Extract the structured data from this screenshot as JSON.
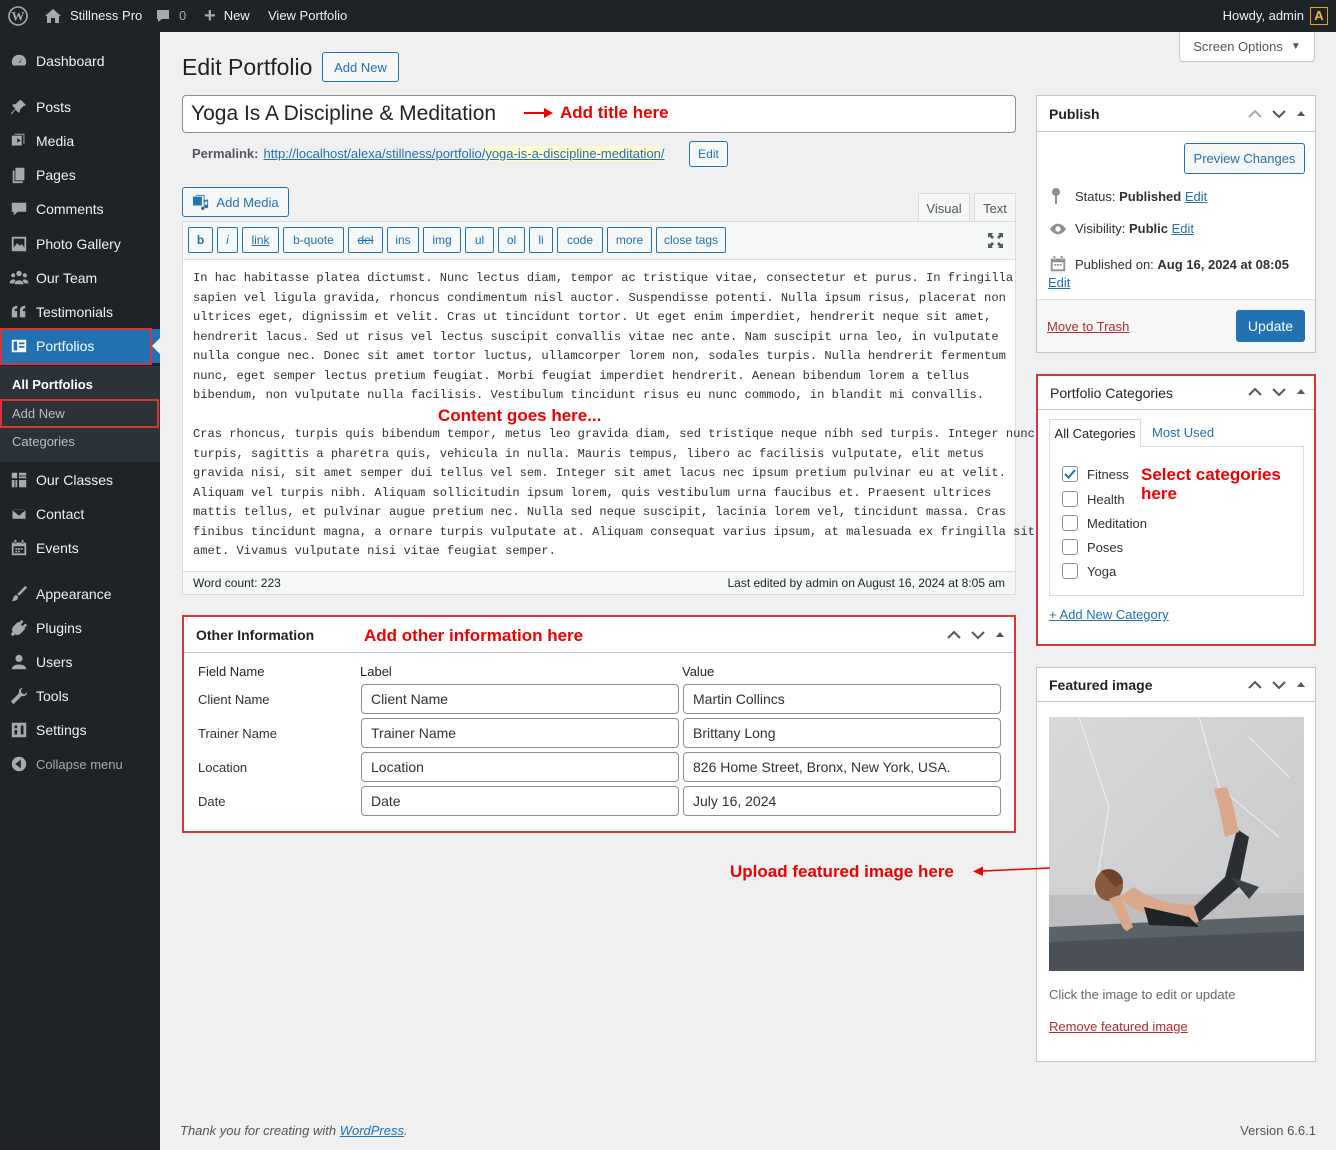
{
  "adminbar": {
    "site_name": "Stillness Pro",
    "comments_count": "0",
    "new_label": "New",
    "view_label": "View Portfolio",
    "greeting": "Howdy, admin"
  },
  "sidebar": {
    "items": [
      {
        "label": "Dashboard",
        "icon": "dashboard-icon"
      },
      {
        "label": "Posts",
        "icon": "pin-icon"
      },
      {
        "label": "Media",
        "icon": "media-icon"
      },
      {
        "label": "Pages",
        "icon": "pages-icon"
      },
      {
        "label": "Comments",
        "icon": "comment-icon"
      },
      {
        "label": "Photo Gallery",
        "icon": "gallery-icon"
      },
      {
        "label": "Our Team",
        "icon": "groups-icon"
      },
      {
        "label": "Testimonials",
        "icon": "quote-icon"
      },
      {
        "label": "Portfolios",
        "icon": "portfolio-icon"
      },
      {
        "label": "Our Classes",
        "icon": "grid-icon"
      },
      {
        "label": "Contact",
        "icon": "email-icon"
      },
      {
        "label": "Events",
        "icon": "calendar-icon"
      },
      {
        "label": "Appearance",
        "icon": "brush-icon"
      },
      {
        "label": "Plugins",
        "icon": "plugin-icon"
      },
      {
        "label": "Users",
        "icon": "user-icon"
      },
      {
        "label": "Tools",
        "icon": "wrench-icon"
      },
      {
        "label": "Settings",
        "icon": "settings-icon"
      },
      {
        "label": "Collapse menu",
        "icon": "collapse-icon"
      }
    ],
    "submenu": [
      "All Portfolios",
      "Add New",
      "Categories"
    ]
  },
  "screen_options": "Screen Options",
  "page": {
    "title": "Edit Portfolio",
    "add_new": "Add New",
    "post_title": "Yoga Is A Discipline & Meditation",
    "permalink_label": "Permalink:",
    "permalink_base": "http://localhost/alexa/stillness/portfolio/",
    "permalink_slug": "yoga-is-a-discipline-meditation",
    "permalink_end": "/",
    "permalink_edit": "Edit"
  },
  "editor": {
    "add_media": "Add Media",
    "tab_visual": "Visual",
    "tab_text": "Text",
    "quicktags": [
      "b",
      "i",
      "link",
      "b-quote",
      "del",
      "ins",
      "img",
      "ul",
      "ol",
      "li",
      "code",
      "more",
      "close tags"
    ],
    "content_lines_p1": [
      "In hac habitasse platea dictumst. Nunc lectus diam, tempor ac tristique vitae, consectetur et purus. In fringilla",
      "sapien vel ligula gravida, rhoncus condimentum nisl auctor. Suspendisse potenti. Nulla ipsum risus, placerat non",
      "ultrices eget, dignissim et velit. Cras ut tincidunt tortor. Ut eget enim imperdiet, hendrerit neque sit amet,",
      "hendrerit lacus. Sed ut risus vel lectus suscipit convallis vitae nec ante. Nam suscipit urna leo, in vulputate",
      "nulla congue nec. Donec sit amet tortor luctus, ullamcorper lorem non, sodales turpis. Nulla hendrerit fermentum",
      "nunc, eget semper lectus pretium feugiat. Morbi feugiat imperdiet hendrerit. Aenean bibendum lorem a tellus",
      "bibendum, non vulputate nulla facilisis. Vestibulum tincidunt risus eu nunc commodo, in blandit mi convallis."
    ],
    "content_lines_p2": [
      "Cras rhoncus, turpis quis bibendum tempor, metus leo gravida diam, sed tristique neque nibh sed turpis. Integer nunc",
      "turpis, sagittis a pharetra quis, vehicula in nulla. Mauris tempus, libero ac facilisis vulputate, elit metus",
      "gravida nisi, sit amet semper dui tellus vel sem. Integer sit amet lacus nec ipsum pretium pulvinar eu at velit.",
      "Aliquam vel turpis nibh. Aliquam sollicitudin ipsum lorem, quis vestibulum urna faucibus et. Praesent ultrices",
      "mattis tellus, et pulvinar augue pretium nec. Nulla sed neque suscipit, lacinia lorem vel, tincidunt massa. Cras",
      "finibus tincidunt magna, a ornare turpis vulputate at. Aliquam consequat varius ipsum, at malesuada ex fringilla sit",
      "amet. Vivamus vulputate nisi vitae feugiat semper."
    ],
    "word_count": "Word count: 223",
    "last_edited": "Last edited by admin on August 16, 2024 at 8:05 am"
  },
  "annotations": {
    "title": "Add title here",
    "content": "Content goes here...",
    "other": "Add other information here",
    "categories_line1": "Select categories",
    "categories_line2": "here",
    "featured": "Upload featured image here"
  },
  "other_info": {
    "title": "Other Information",
    "headers": [
      "Field Name",
      "Label",
      "Value"
    ],
    "rows": [
      {
        "field": "Client Name",
        "label": "Client Name",
        "value": "Martin Collincs"
      },
      {
        "field": "Trainer Name",
        "label": "Trainer Name",
        "value": "Brittany Long"
      },
      {
        "field": "Location",
        "label": "Location",
        "value": "826 Home Street, Bronx, New York, USA."
      },
      {
        "field": "Date",
        "label": "Date",
        "value": "July 16, 2024"
      }
    ]
  },
  "publish": {
    "title": "Publish",
    "preview": "Preview Changes",
    "status_label": "Status:",
    "status_value": "Published",
    "visibility_label": "Visibility:",
    "visibility_value": "Public",
    "published_label": "Published on:",
    "published_value": "Aug 16, 2024 at 08:05",
    "edit": "Edit",
    "trash": "Move to Trash",
    "update": "Update"
  },
  "categories": {
    "title": "Portfolio Categories",
    "tab_all": "All Categories",
    "tab_most": "Most Used",
    "items": [
      {
        "name": "Fitness",
        "checked": true
      },
      {
        "name": "Health",
        "checked": false
      },
      {
        "name": "Meditation",
        "checked": false
      },
      {
        "name": "Poses",
        "checked": false
      },
      {
        "name": "Yoga",
        "checked": false
      }
    ],
    "add_new": "+ Add New Category"
  },
  "featured": {
    "title": "Featured image",
    "hint": "Click the image to edit or update",
    "remove": "Remove featured image"
  },
  "footer": {
    "thanks_pre": "Thank you for creating with ",
    "thanks_link": "WordPress",
    "thanks_post": ".",
    "version": "Version 6.6.1"
  },
  "colors": {
    "admin_dark": "#1d2327",
    "accent": "#2271b1",
    "annotation_red": "#e00000"
  }
}
